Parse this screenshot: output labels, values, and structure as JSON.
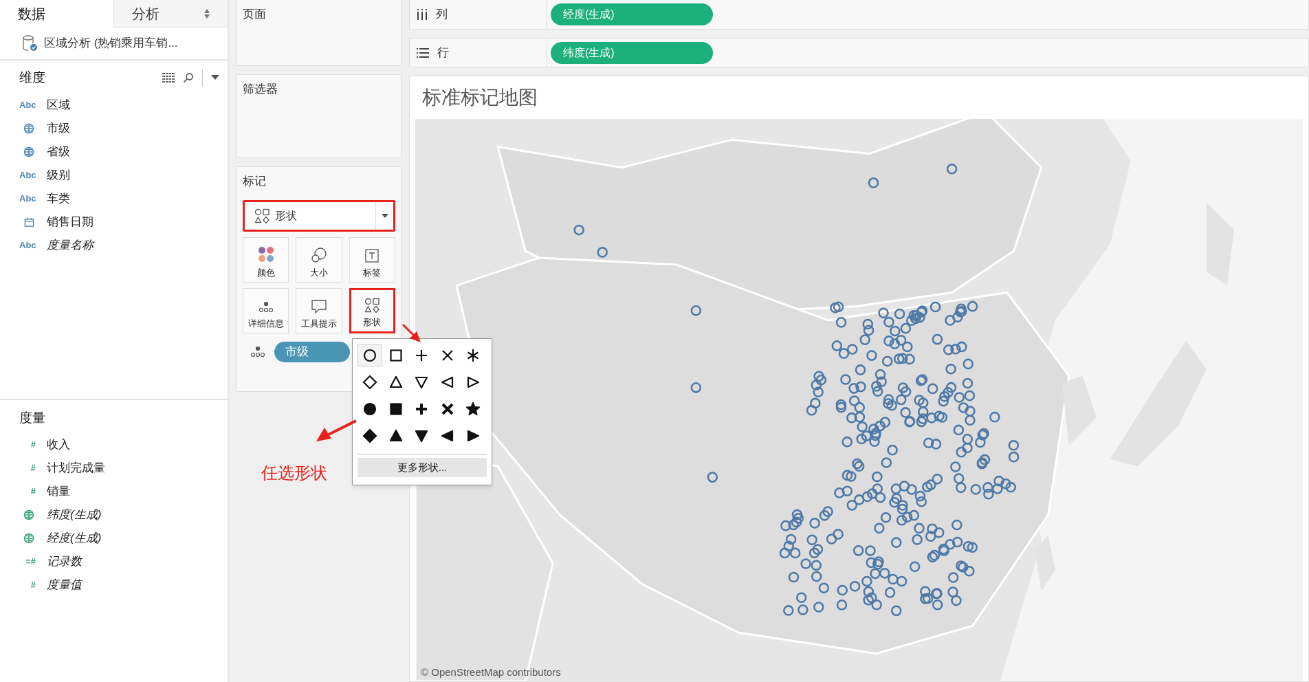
{
  "data_pane": {
    "tabs": [
      {
        "label": "数据",
        "selected": true
      },
      {
        "label": "分析",
        "selected": false
      }
    ],
    "datasource": "区域分析 (热销乘用车销...",
    "dimensions": {
      "title": "维度",
      "fields": [
        {
          "kind": "abc",
          "badge": "Abc",
          "name": "区域",
          "italic": false
        },
        {
          "kind": "globe",
          "name": "市级",
          "italic": false
        },
        {
          "kind": "globe",
          "name": "省级",
          "italic": false
        },
        {
          "kind": "abc",
          "badge": "Abc",
          "name": "级别",
          "italic": false
        },
        {
          "kind": "abc",
          "badge": "Abc",
          "name": "车类",
          "italic": false
        },
        {
          "kind": "calendar",
          "name": "销售日期",
          "italic": false
        },
        {
          "kind": "abc",
          "badge": "Abc",
          "name": "度量名称",
          "italic": true
        }
      ]
    },
    "measures": {
      "title": "度量",
      "fields": [
        {
          "kind": "number",
          "badge": "#",
          "name": "收入",
          "italic": false
        },
        {
          "kind": "number",
          "badge": "#",
          "name": "计划完成量",
          "italic": false
        },
        {
          "kind": "number",
          "badge": "#",
          "name": "销量",
          "italic": false
        },
        {
          "kind": "globe",
          "name": "纬度(生成)",
          "italic": true
        },
        {
          "kind": "globe",
          "name": "经度(生成)",
          "italic": true
        },
        {
          "kind": "number",
          "badge": "=#",
          "name": "记录数",
          "italic": true
        },
        {
          "kind": "number",
          "badge": "#",
          "name": "度量值",
          "italic": true
        }
      ]
    }
  },
  "pages_card": {
    "title": "页面"
  },
  "filters_card": {
    "title": "筛选器"
  },
  "marks_card": {
    "title": "标记",
    "mark_type": {
      "label": "形状",
      "annotated": true
    },
    "buttons": [
      {
        "kind": "color",
        "label": "颜色",
        "annotated": false
      },
      {
        "kind": "size",
        "label": "大小",
        "annotated": false
      },
      {
        "kind": "label",
        "label": "标签",
        "annotated": false
      },
      {
        "kind": "detail",
        "label": "详细信息",
        "annotated": false
      },
      {
        "kind": "tooltip",
        "label": "工具提示",
        "annotated": false
      },
      {
        "kind": "shape",
        "label": "形状",
        "annotated": true
      }
    ],
    "pill": {
      "label": "市级"
    }
  },
  "shelves": [
    {
      "kind": "columns",
      "label": "列",
      "pill": "经度(生成)"
    },
    {
      "kind": "rows",
      "label": "行",
      "pill": "纬度(生成)"
    }
  ],
  "sheet": {
    "title": "标准标记地图",
    "attribution": "© OpenStreetMap contributors"
  },
  "shape_palette": {
    "shapes": [
      {
        "kind": "circle",
        "filled": false,
        "selected": true
      },
      {
        "kind": "square",
        "filled": false,
        "selected": false
      },
      {
        "kind": "plus",
        "filled": false,
        "selected": false
      },
      {
        "kind": "cross",
        "filled": false,
        "selected": false
      },
      {
        "kind": "asterisk",
        "filled": false,
        "selected": false
      },
      {
        "kind": "diamond",
        "filled": false,
        "selected": false
      },
      {
        "kind": "up",
        "filled": false,
        "selected": false
      },
      {
        "kind": "down",
        "filled": false,
        "selected": false
      },
      {
        "kind": "left",
        "filled": false,
        "selected": false
      },
      {
        "kind": "right",
        "filled": false,
        "selected": false
      },
      {
        "kind": "circle",
        "filled": true,
        "selected": false
      },
      {
        "kind": "square",
        "filled": true,
        "selected": false
      },
      {
        "kind": "plus",
        "filled": true,
        "selected": false
      },
      {
        "kind": "cross",
        "filled": true,
        "selected": false
      },
      {
        "kind": "star",
        "filled": true,
        "selected": false
      },
      {
        "kind": "diamond",
        "filled": true,
        "selected": false
      },
      {
        "kind": "up",
        "filled": true,
        "selected": false
      },
      {
        "kind": "down",
        "filled": true,
        "selected": false
      },
      {
        "kind": "left",
        "filled": true,
        "selected": false
      },
      {
        "kind": "right",
        "filled": true,
        "selected": false
      }
    ],
    "more_button": "更多形状..."
  },
  "annotation": {
    "text": "任选形状"
  }
}
